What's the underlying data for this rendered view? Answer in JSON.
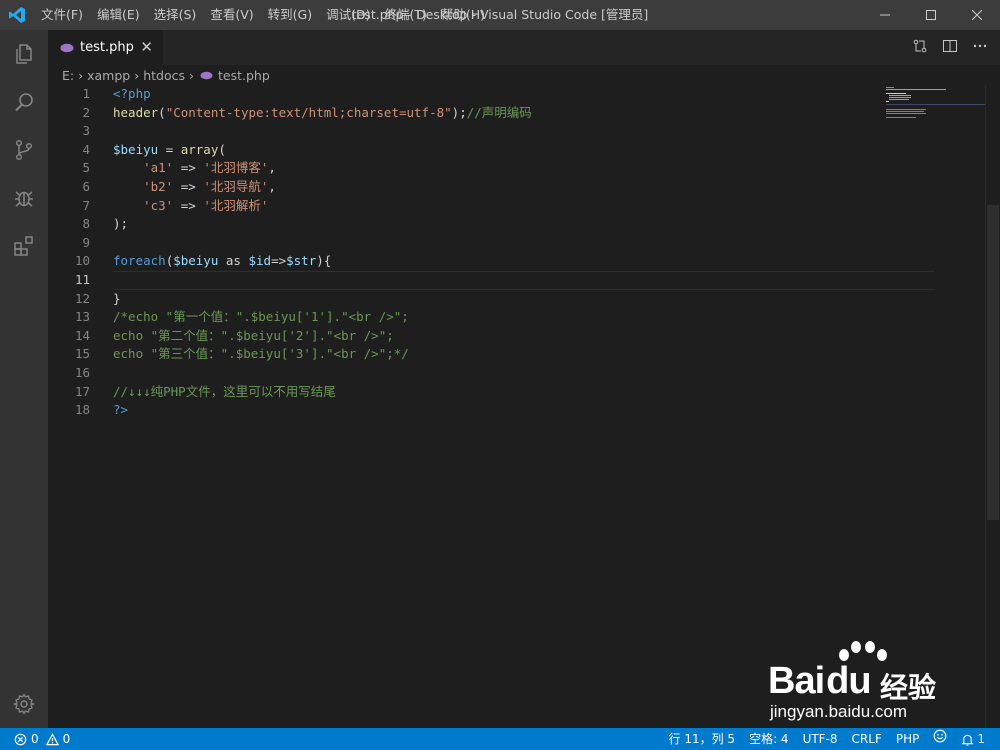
{
  "window": {
    "title": "test.php - Desktop - Visual Studio Code [管理员]",
    "menu": [
      "文件(F)",
      "编辑(E)",
      "选择(S)",
      "查看(V)",
      "转到(G)",
      "调试(D)",
      "终端(T)",
      "帮助(H)"
    ]
  },
  "tab": {
    "label": "test.php",
    "close": "✕"
  },
  "breadcrumb": [
    "E:",
    "xampp",
    "htdocs",
    "test.php"
  ],
  "editor": {
    "line_numbers": [
      "1",
      "2",
      "3",
      "4",
      "5",
      "6",
      "7",
      "8",
      "9",
      "10",
      "11",
      "12",
      "13",
      "14",
      "15",
      "16",
      "17",
      "18"
    ],
    "active_line": 11,
    "code": [
      [
        {
          "t": "<?php",
          "c": "tag"
        }
      ],
      [
        {
          "t": "header",
          "c": "fn"
        },
        {
          "t": "(",
          "c": "pl"
        },
        {
          "t": "\"Content-type:text/html;charset=utf-8\"",
          "c": "str"
        },
        {
          "t": ");",
          "c": "pl"
        },
        {
          "t": "//声明编码",
          "c": "com"
        }
      ],
      [],
      [
        {
          "t": "$beiyu",
          "c": "var"
        },
        {
          "t": " = ",
          "c": "pl"
        },
        {
          "t": "array",
          "c": "fn"
        },
        {
          "t": "(",
          "c": "pl"
        }
      ],
      [
        {
          "t": "    ",
          "c": "pl"
        },
        {
          "t": "'a1'",
          "c": "str"
        },
        {
          "t": " => ",
          "c": "pl"
        },
        {
          "t": "'北羽博客'",
          "c": "str"
        },
        {
          "t": ",",
          "c": "pl"
        }
      ],
      [
        {
          "t": "    ",
          "c": "pl"
        },
        {
          "t": "'b2'",
          "c": "str"
        },
        {
          "t": " => ",
          "c": "pl"
        },
        {
          "t": "'北羽导航'",
          "c": "str"
        },
        {
          "t": ",",
          "c": "pl"
        }
      ],
      [
        {
          "t": "    ",
          "c": "pl"
        },
        {
          "t": "'c3'",
          "c": "str"
        },
        {
          "t": " => ",
          "c": "pl"
        },
        {
          "t": "'北羽解析'",
          "c": "str"
        }
      ],
      [
        {
          "t": ");",
          "c": "pl"
        }
      ],
      [],
      [
        {
          "t": "foreach",
          "c": "tag"
        },
        {
          "t": "(",
          "c": "pl"
        },
        {
          "t": "$beiyu",
          "c": "var"
        },
        {
          "t": " as ",
          "c": "pl"
        },
        {
          "t": "$id",
          "c": "var"
        },
        {
          "t": "=>",
          "c": "pl"
        },
        {
          "t": "$str",
          "c": "var"
        },
        {
          "t": "){",
          "c": "pl"
        }
      ],
      [],
      [
        {
          "t": "}",
          "c": "pl"
        }
      ],
      [
        {
          "t": "/*echo \"第一个值：\".$beiyu['1'].\"<br />\";",
          "c": "com"
        }
      ],
      [
        {
          "t": "echo \"第二个值：\".$beiyu['2'].\"<br />\";",
          "c": "com"
        }
      ],
      [
        {
          "t": "echo \"第三个值：\".$beiyu['3'].\"<br />\";*/",
          "c": "com"
        }
      ],
      [],
      [
        {
          "t": "//↓↓↓纯PHP文件，这里可以不用写结尾",
          "c": "com"
        }
      ],
      [
        {
          "t": "?>",
          "c": "tag"
        }
      ]
    ]
  },
  "status": {
    "errors": "0",
    "warnings": "0",
    "position": "行 11，列 5",
    "spaces": "空格: 4",
    "encoding": "UTF-8",
    "eol": "CRLF",
    "language": "PHP",
    "notifications": "1"
  },
  "watermark": {
    "logo": "Bai",
    "logo_du": "du",
    "cn": "经验",
    "url": "jingyan.baidu.com"
  },
  "colors": {
    "accent": "#007acc",
    "titlebar": "#3c3c3c",
    "activitybar": "#333333",
    "editor_bg": "#1e1e1e"
  },
  "icons": [
    "vscode-logo-icon",
    "files-icon",
    "search-icon",
    "source-control-icon",
    "debug-icon",
    "extensions-icon",
    "settings-gear-icon",
    "php-file-icon",
    "split-editor-icon",
    "more-icon"
  ]
}
